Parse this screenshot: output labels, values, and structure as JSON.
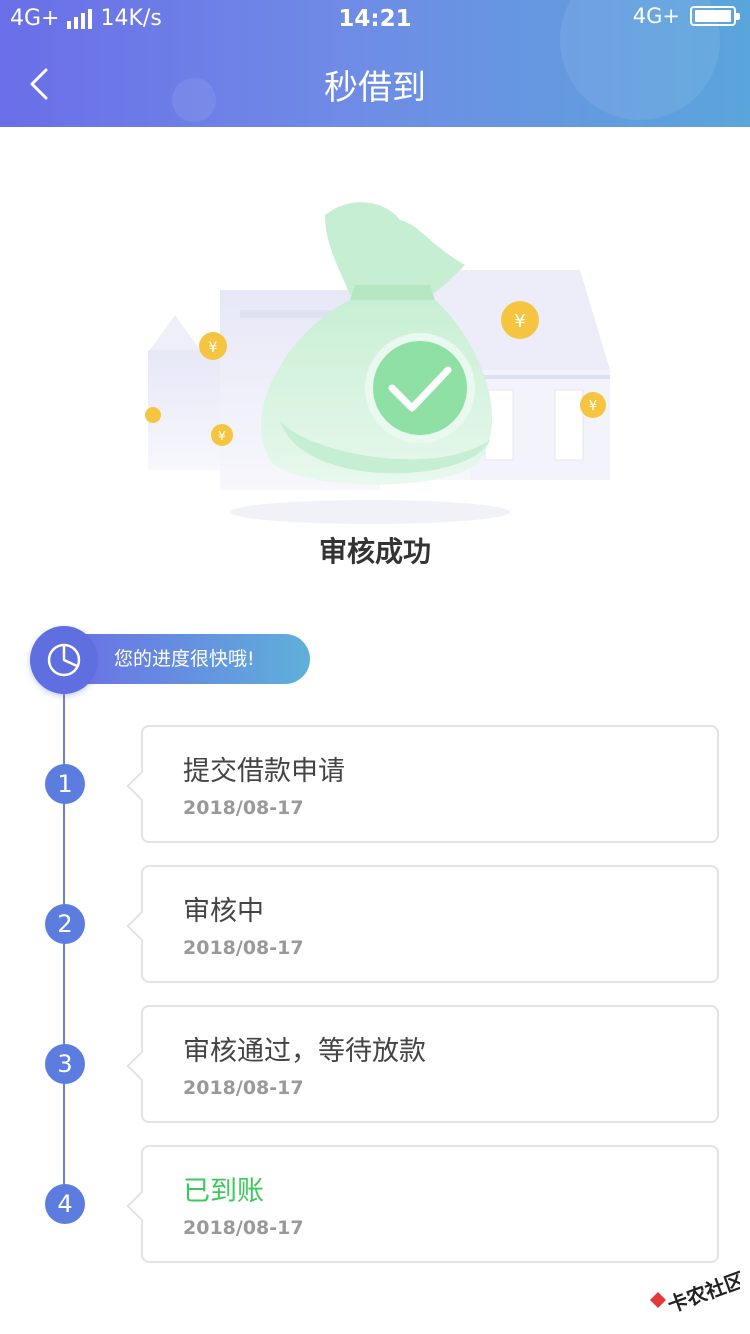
{
  "status_bar": {
    "network_left": "4G+",
    "speed": "14K/s",
    "time": "14:21",
    "network_right": "4G+"
  },
  "header": {
    "title": "秒借到",
    "back_icon": "chevron-left-icon"
  },
  "result": {
    "title": "审核成功",
    "icon": "check-circle-icon"
  },
  "progress": {
    "message": "您的进度很快哦!",
    "icon": "pie-chart-icon"
  },
  "steps": [
    {
      "number": "1",
      "label": "提交借款申请",
      "date": "2018/08-17"
    },
    {
      "number": "2",
      "label": "审核中",
      "date": "2018/08-17"
    },
    {
      "number": "3",
      "label": "审核通过，等待放款",
      "date": "2018/08-17"
    },
    {
      "number": "4",
      "label": "已到账",
      "date": "2018/08-17"
    }
  ],
  "watermark": {
    "text": "卡农社区"
  },
  "colors": {
    "header_start": "#6a6ee8",
    "header_end": "#5aa5dc",
    "success_green": "#3cc85c",
    "step_blue": "#5c7ce0"
  }
}
